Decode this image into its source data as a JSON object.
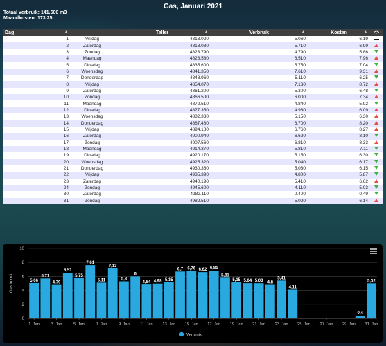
{
  "page": {
    "title": "Gas, Januari 2021",
    "summary_total": "Totaal verbruik: 141.600 m3",
    "summary_cost": "Maandkosten: 173.25"
  },
  "table": {
    "headers": [
      "Dag",
      "Teller",
      "Verbruik",
      "Kosten",
      "<>"
    ],
    "rows": [
      [
        "1",
        "Vrijdag",
        "4813.020",
        "5.060",
        "6.19",
        "eq"
      ],
      [
        "2",
        "Zaterdag",
        "4818.080",
        "5.710",
        "6.99",
        "up"
      ],
      [
        "3",
        "Zondag",
        "4823.790",
        "4.790",
        "5.86",
        "down"
      ],
      [
        "4",
        "Maandag",
        "4828.580",
        "6.510",
        "7.96",
        "up"
      ],
      [
        "5",
        "Dinsdag",
        "4835.600",
        "5.750",
        "7.04",
        "down"
      ],
      [
        "6",
        "Woensdag",
        "4841.350",
        "7.610",
        "9.31",
        "up"
      ],
      [
        "7",
        "Donderdag",
        "4848.960",
        "5.110",
        "6.25",
        "down"
      ],
      [
        "8",
        "Vrijdag",
        "4854.070",
        "7.130",
        "8.72",
        "up"
      ],
      [
        "9",
        "Zaterdag",
        "4861.200",
        "5.300",
        "6.48",
        "down"
      ],
      [
        "10",
        "Zondag",
        "4866.500",
        "6.000",
        "7.34",
        "up"
      ],
      [
        "11",
        "Maandag",
        "4872.510",
        "4.840",
        "5.92",
        "down"
      ],
      [
        "12",
        "Dinsdag",
        "4877.350",
        "4.980",
        "6.09",
        "up"
      ],
      [
        "13",
        "Woensdag",
        "4882.330",
        "5.150",
        "6.30",
        "up"
      ],
      [
        "14",
        "Donderdag",
        "4887.480",
        "6.700",
        "8.20",
        "up"
      ],
      [
        "15",
        "Vrijdag",
        "4894.180",
        "6.760",
        "8.27",
        "up"
      ],
      [
        "16",
        "Zaterdag",
        "4900.940",
        "6.620",
        "8.10",
        "down"
      ],
      [
        "17",
        "Zondag",
        "4907.560",
        "6.810",
        "8.33",
        "up"
      ],
      [
        "18",
        "Maandag",
        "4914.370",
        "5.810",
        "7.11",
        "down"
      ],
      [
        "19",
        "Dinsdag",
        "4920.170",
        "5.150",
        "6.30",
        "down"
      ],
      [
        "20",
        "Woensdag",
        "4925.320",
        "5.040",
        "6.17",
        "down"
      ],
      [
        "21",
        "Donderdag",
        "4930.360",
        "5.030",
        "6.15",
        "down"
      ],
      [
        "22",
        "Vrijdag",
        "4935.390",
        "4.800",
        "5.87",
        "down"
      ],
      [
        "23",
        "Zaterdag",
        "4940.190",
        "5.410",
        "6.62",
        "up"
      ],
      [
        "24",
        "Zondag",
        "4945.600",
        "4.110",
        "5.03",
        "down"
      ],
      [
        "30",
        "Zaterdag",
        "4982.110",
        "0.400",
        "0.49",
        "down"
      ],
      [
        "31",
        "Zondag",
        "4982.510",
        "5.020",
        "6.14",
        "up"
      ]
    ]
  },
  "chart_data": {
    "type": "bar",
    "ylabel": "Gas in m3",
    "ylim": [
      0,
      10
    ],
    "yticks": [
      0,
      2,
      4,
      6,
      8,
      10
    ],
    "xtick_labels": [
      "1. Jan",
      "3. Jan",
      "5. Jan",
      "7. Jan",
      "9. Jan",
      "11. Jan",
      "13. Jan",
      "15. Jan",
      "17. Jan",
      "19. Jan",
      "21. Jan",
      "23. Jan",
      "25. Jan",
      "27. Jan",
      "29. Jan",
      "31. Jan"
    ],
    "series": [
      {
        "name": "Verbruik",
        "color": "#29a9e0",
        "days": [
          1,
          2,
          3,
          4,
          5,
          6,
          7,
          8,
          9,
          10,
          11,
          12,
          13,
          14,
          15,
          16,
          17,
          18,
          19,
          20,
          21,
          22,
          23,
          24,
          30,
          31
        ],
        "values": [
          5.06,
          5.71,
          4.79,
          6.51,
          5.75,
          7.61,
          5.11,
          7.13,
          5.3,
          6,
          4.84,
          4.98,
          5.15,
          6.7,
          6.76,
          6.62,
          6.81,
          5.81,
          5.15,
          5.04,
          5.03,
          4.8,
          5.41,
          4.11,
          0.4,
          5.02
        ],
        "labels": [
          "5,06",
          "5,71",
          "4,79",
          "6,51",
          "5,75",
          "7,61",
          "5,11",
          "7,13",
          "5,3",
          "6",
          "4,84",
          "4,98",
          "5,15",
          "6,7",
          "6,76",
          "6,62",
          "6,81",
          "5,81",
          "5,15",
          "5,04",
          "5,03",
          "4,8",
          "5,41",
          "4,11",
          "0,4",
          "5,02"
        ]
      }
    ],
    "legend": "bottom-center",
    "grid": true
  }
}
